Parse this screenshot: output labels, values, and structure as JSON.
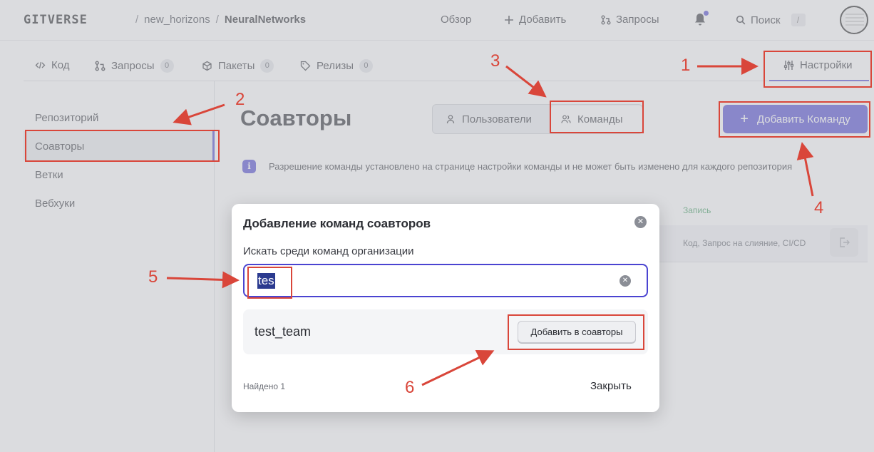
{
  "header": {
    "logo": "GITVERSE",
    "owner": "new_horizons",
    "repo": "NeuralNetworks",
    "nav": {
      "overview": "Обзор",
      "add": "Добавить",
      "requests": "Запросы",
      "search": "Поиск",
      "search_shortcut": "/"
    }
  },
  "tabs": {
    "code": "Код",
    "requests": "Запросы",
    "requests_count": "0",
    "packages": "Пакеты",
    "packages_count": "0",
    "releases": "Релизы",
    "releases_count": "0",
    "settings": "Настройки"
  },
  "sidebar": {
    "items": [
      {
        "label": "Репозиторий"
      },
      {
        "label": "Соавторы",
        "active": true
      },
      {
        "label": "Ветки"
      },
      {
        "label": "Вебхуки"
      }
    ]
  },
  "main": {
    "title": "Соавторы",
    "segments": {
      "users": "Пользователи",
      "teams": "Команды"
    },
    "add_team_button": "Добавить Команду",
    "info_text": "Разрешение команды установлено на странице настройки команды и не может быть изменено для каждого репозитория",
    "table": {
      "column_write": "Запись",
      "row_permissions": "Код, Запрос на слияние, CI/CD"
    }
  },
  "modal": {
    "title": "Добавление команд соавторов",
    "search_label": "Искать среди команд организации",
    "search_value": "tes",
    "result_name": "test_team",
    "result_button": "Добавить в соавторы",
    "found_text": "Найдено 1",
    "close_label": "Закрыть"
  },
  "annotations": [
    "1",
    "2",
    "3",
    "4",
    "5",
    "6"
  ],
  "colors": {
    "accent": "#4a44d1",
    "annotation": "#d9463a"
  }
}
